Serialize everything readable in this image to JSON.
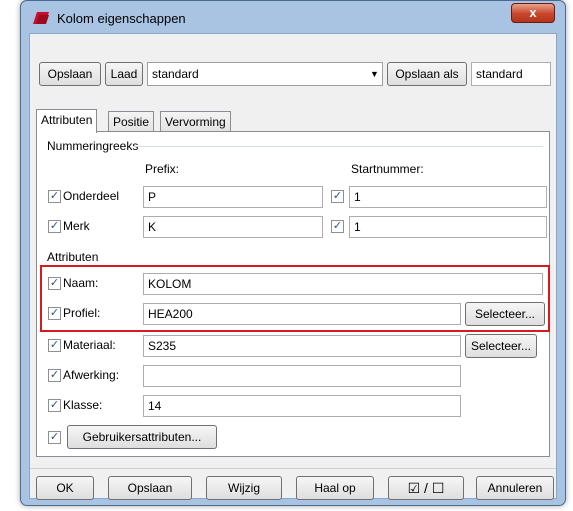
{
  "window": {
    "title": "Kolom eigenschappen",
    "close_glyph": "x",
    "accent_color": "#d8191f"
  },
  "toolbar": {
    "save_label": "Opslaan",
    "load_label": "Laad",
    "preset_value": "standard",
    "save_as_label": "Opslaan als",
    "save_as_value": "standard"
  },
  "tabs": [
    {
      "label": "Attributen"
    },
    {
      "label": "Positie"
    },
    {
      "label": "Vervorming"
    }
  ],
  "numbering": {
    "group_label": "Nummeringreeks",
    "prefix_header": "Prefix:",
    "start_header": "Startnummer:",
    "rows": [
      {
        "label": "Onderdeel",
        "prefix": "P",
        "start": "1"
      },
      {
        "label": "Merk",
        "prefix": "K",
        "start": "1"
      }
    ]
  },
  "attributes": {
    "group_label": "Attributen",
    "name_label": "Naam:",
    "name_value": "KOLOM",
    "profile_label": "Profiel:",
    "profile_value": "HEA200",
    "profile_select": "Selecteer...",
    "material_label": "Materiaal:",
    "material_value": "S235",
    "material_select": "Selecteer...",
    "finish_label": "Afwerking:",
    "finish_value": "",
    "class_label": "Klasse:",
    "class_value": "14",
    "user_attributes": "Gebruikersattributen..."
  },
  "footer": {
    "ok": "OK",
    "save": "Opslaan",
    "modify": "Wijzig",
    "get": "Haal op",
    "toggle": "☑ / ☐",
    "cancel": "Annuleren"
  }
}
